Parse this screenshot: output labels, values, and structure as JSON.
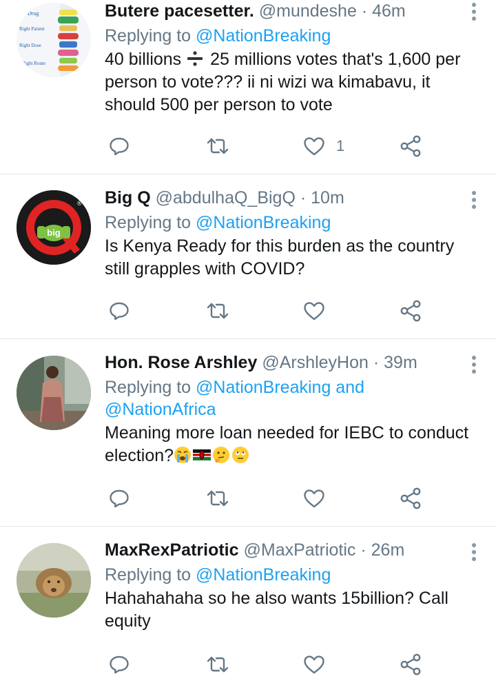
{
  "tweets": [
    {
      "name": "Butere pacesetter.",
      "handle": "@mundeshe",
      "time": "· 46m",
      "replying_prefix": "Replying to ",
      "replying_to": "@NationBreaking",
      "text": "40 billions ➗ 25 millions votes that's 1,600 per person to vote??? ii ni wizi wa kimabavu, it should 500 per person to vote",
      "text_part1": "40 billions ",
      "text_part2": " 25 millions votes that's 1,600 per person to vote??? ii ni wizi wa kimabavu, it should 500 per person to vote",
      "like_count": "1",
      "avatar_labels": [
        "Drug",
        "Right Patient",
        "Right Dose",
        "Right Route"
      ]
    },
    {
      "name": "Big Q",
      "handle": "@abdulhaQ_BigQ",
      "time": "· 10m",
      "replying_prefix": "Replying to ",
      "replying_to": "@NationBreaking",
      "text": "Is Kenya Ready for this burden as the country still grapples with COVID?",
      "like_count": "",
      "avatar_label": "big",
      "avatar_mark": "®"
    },
    {
      "name": "Hon. Rose Arshley",
      "handle": "@ArshleyHon",
      "time": "· 39m",
      "replying_prefix": "Replying to ",
      "replying_to": "@NationBreaking and @NationAfrica",
      "text": "Meaning more loan needed for IEBC to conduct election?",
      "emojis": [
        "crying-face",
        "kenya-flag",
        "thinking-face",
        "eye-roll-face"
      ],
      "like_count": ""
    },
    {
      "name": "MaxRexPatriotic",
      "handle": "@MaxPatriotic",
      "time": "· 26m",
      "replying_prefix": "Replying to ",
      "replying_to": "@NationBreaking",
      "text": "Hahahahaha so he also wants 15billion? Call equity",
      "like_count": ""
    }
  ],
  "icons": [
    "reply-icon",
    "retweet-icon",
    "like-icon",
    "share-icon",
    "more-icon"
  ],
  "colors": {
    "link": "#1da1f2",
    "secondary": "#657786",
    "text": "#14171a",
    "divider": "#e1e8ed"
  }
}
